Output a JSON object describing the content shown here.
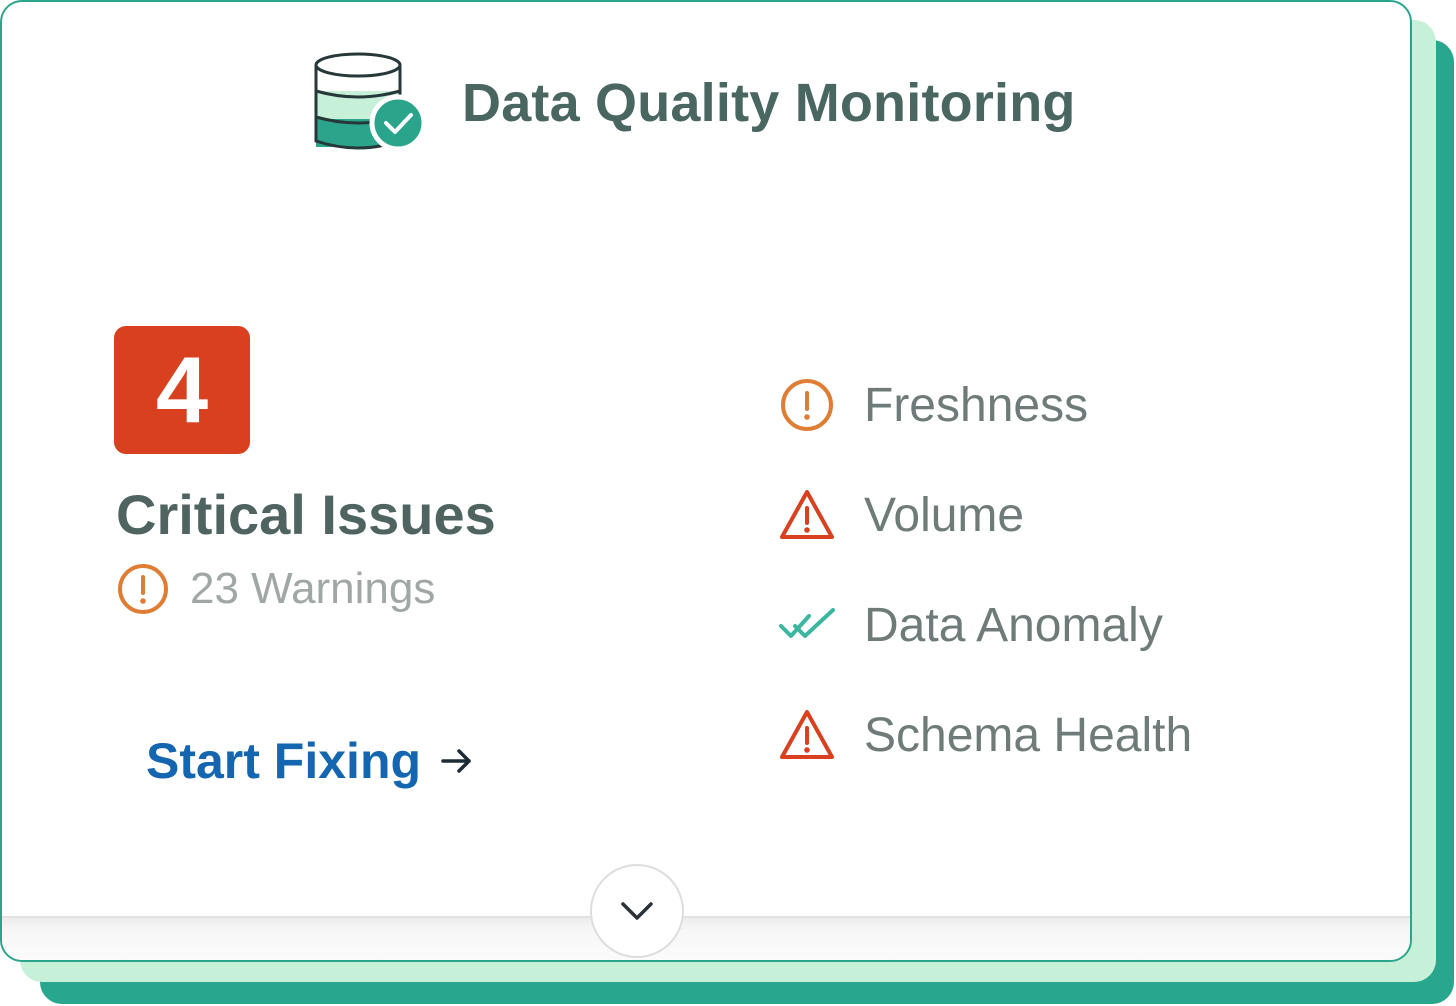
{
  "card": {
    "title": "Data Quality Monitoring",
    "header_icon": "database-check-icon"
  },
  "summary": {
    "critical_count": "4",
    "critical_label": "Critical Issues",
    "warnings_text": "23 Warnings",
    "warnings_icon": "alert-circle-icon"
  },
  "action": {
    "label": "Start Fixing",
    "icon": "arrow-right-icon"
  },
  "checks": [
    {
      "label": "Freshness",
      "icon": "alert-circle-icon",
      "status": "warning"
    },
    {
      "label": "Volume",
      "icon": "alert-triangle-icon",
      "status": "critical"
    },
    {
      "label": "Data Anomaly",
      "icon": "double-check-icon",
      "status": "ok"
    },
    {
      "label": "Schema Health",
      "icon": "alert-triangle-icon",
      "status": "critical"
    }
  ],
  "footer": {
    "expand_icon": "chevron-down-icon"
  },
  "colors": {
    "accent": "#2aa58c",
    "accent_light": "#c7f0d8",
    "critical": "#d9401f",
    "warning": "#e07d35",
    "ok": "#3bb7a0",
    "link": "#1466b0",
    "title": "#4a6660"
  }
}
